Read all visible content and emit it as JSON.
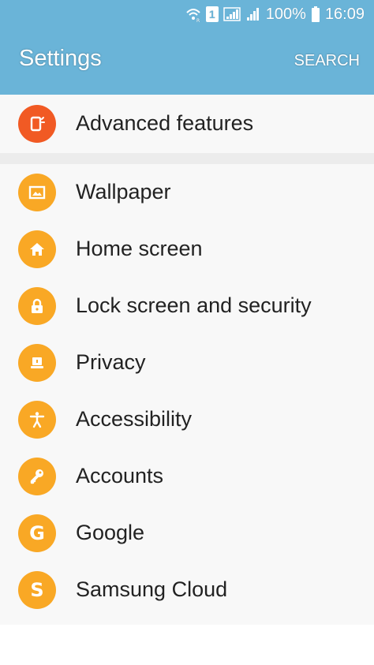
{
  "status_bar": {
    "battery_percent": "100%",
    "time": "16:09",
    "sim_number": "1",
    "icons": [
      "wifi-icon",
      "sim-icon",
      "signal-icon",
      "signal-icon",
      "battery-icon"
    ]
  },
  "app_bar": {
    "title": "Settings",
    "search_label": "SEARCH",
    "color": "#6ab4d8"
  },
  "settings": {
    "top_item": {
      "label": "Advanced features",
      "icon": "advanced-features-icon",
      "color": "#f15a24"
    },
    "items": [
      {
        "label": "Wallpaper",
        "icon": "wallpaper-icon",
        "color": "#f9a825"
      },
      {
        "label": "Home screen",
        "icon": "home-icon",
        "color": "#f9a825"
      },
      {
        "label": "Lock screen and security",
        "icon": "lock-icon",
        "color": "#f9a825"
      },
      {
        "label": "Privacy",
        "icon": "privacy-icon",
        "color": "#f9a825"
      },
      {
        "label": "Accessibility",
        "icon": "accessibility-icon",
        "color": "#f9a825"
      },
      {
        "label": "Accounts",
        "icon": "key-icon",
        "color": "#f9a825"
      },
      {
        "label": "Google",
        "icon": "google-icon",
        "glyph": "G",
        "color": "#f9a825"
      },
      {
        "label": "Samsung Cloud",
        "icon": "samsung-cloud-icon",
        "glyph": "S",
        "color": "#f9a825"
      }
    ]
  }
}
